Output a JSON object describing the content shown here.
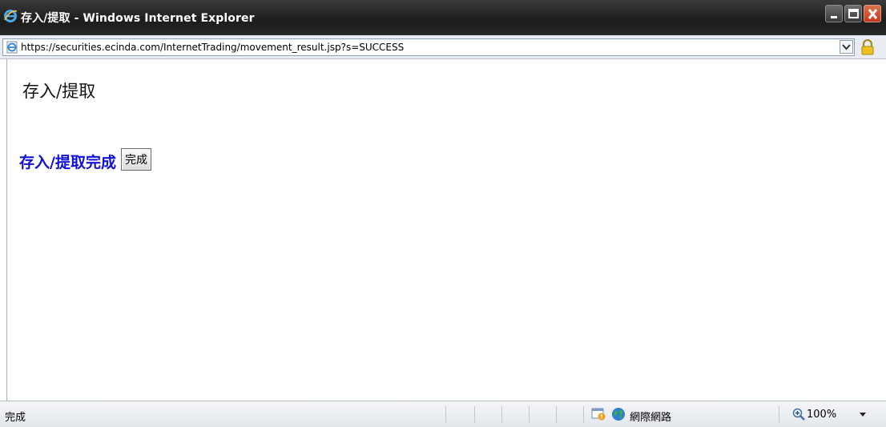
{
  "window": {
    "title": "存入/提取 - Windows Internet Explorer"
  },
  "address_bar": {
    "url": "https://securities.ecinda.com/InternetTrading/movement_result.jsp?s=SUCCESS"
  },
  "page": {
    "heading": "存入/提取",
    "result_message": "存入/提取完成",
    "done_button_label": "完成",
    "result_color": "#1010d8"
  },
  "status_bar": {
    "status_text": "完成",
    "zone_text": "網際網路",
    "zoom_text": "100%"
  },
  "icons": [
    "ie-logo-icon",
    "minimize-icon",
    "maximize-icon",
    "close-icon",
    "page-icon",
    "dropdown-arrow-icon",
    "lock-icon",
    "security-warning-icon",
    "globe-icon",
    "zoom-icon",
    "chevron-down-icon"
  ]
}
